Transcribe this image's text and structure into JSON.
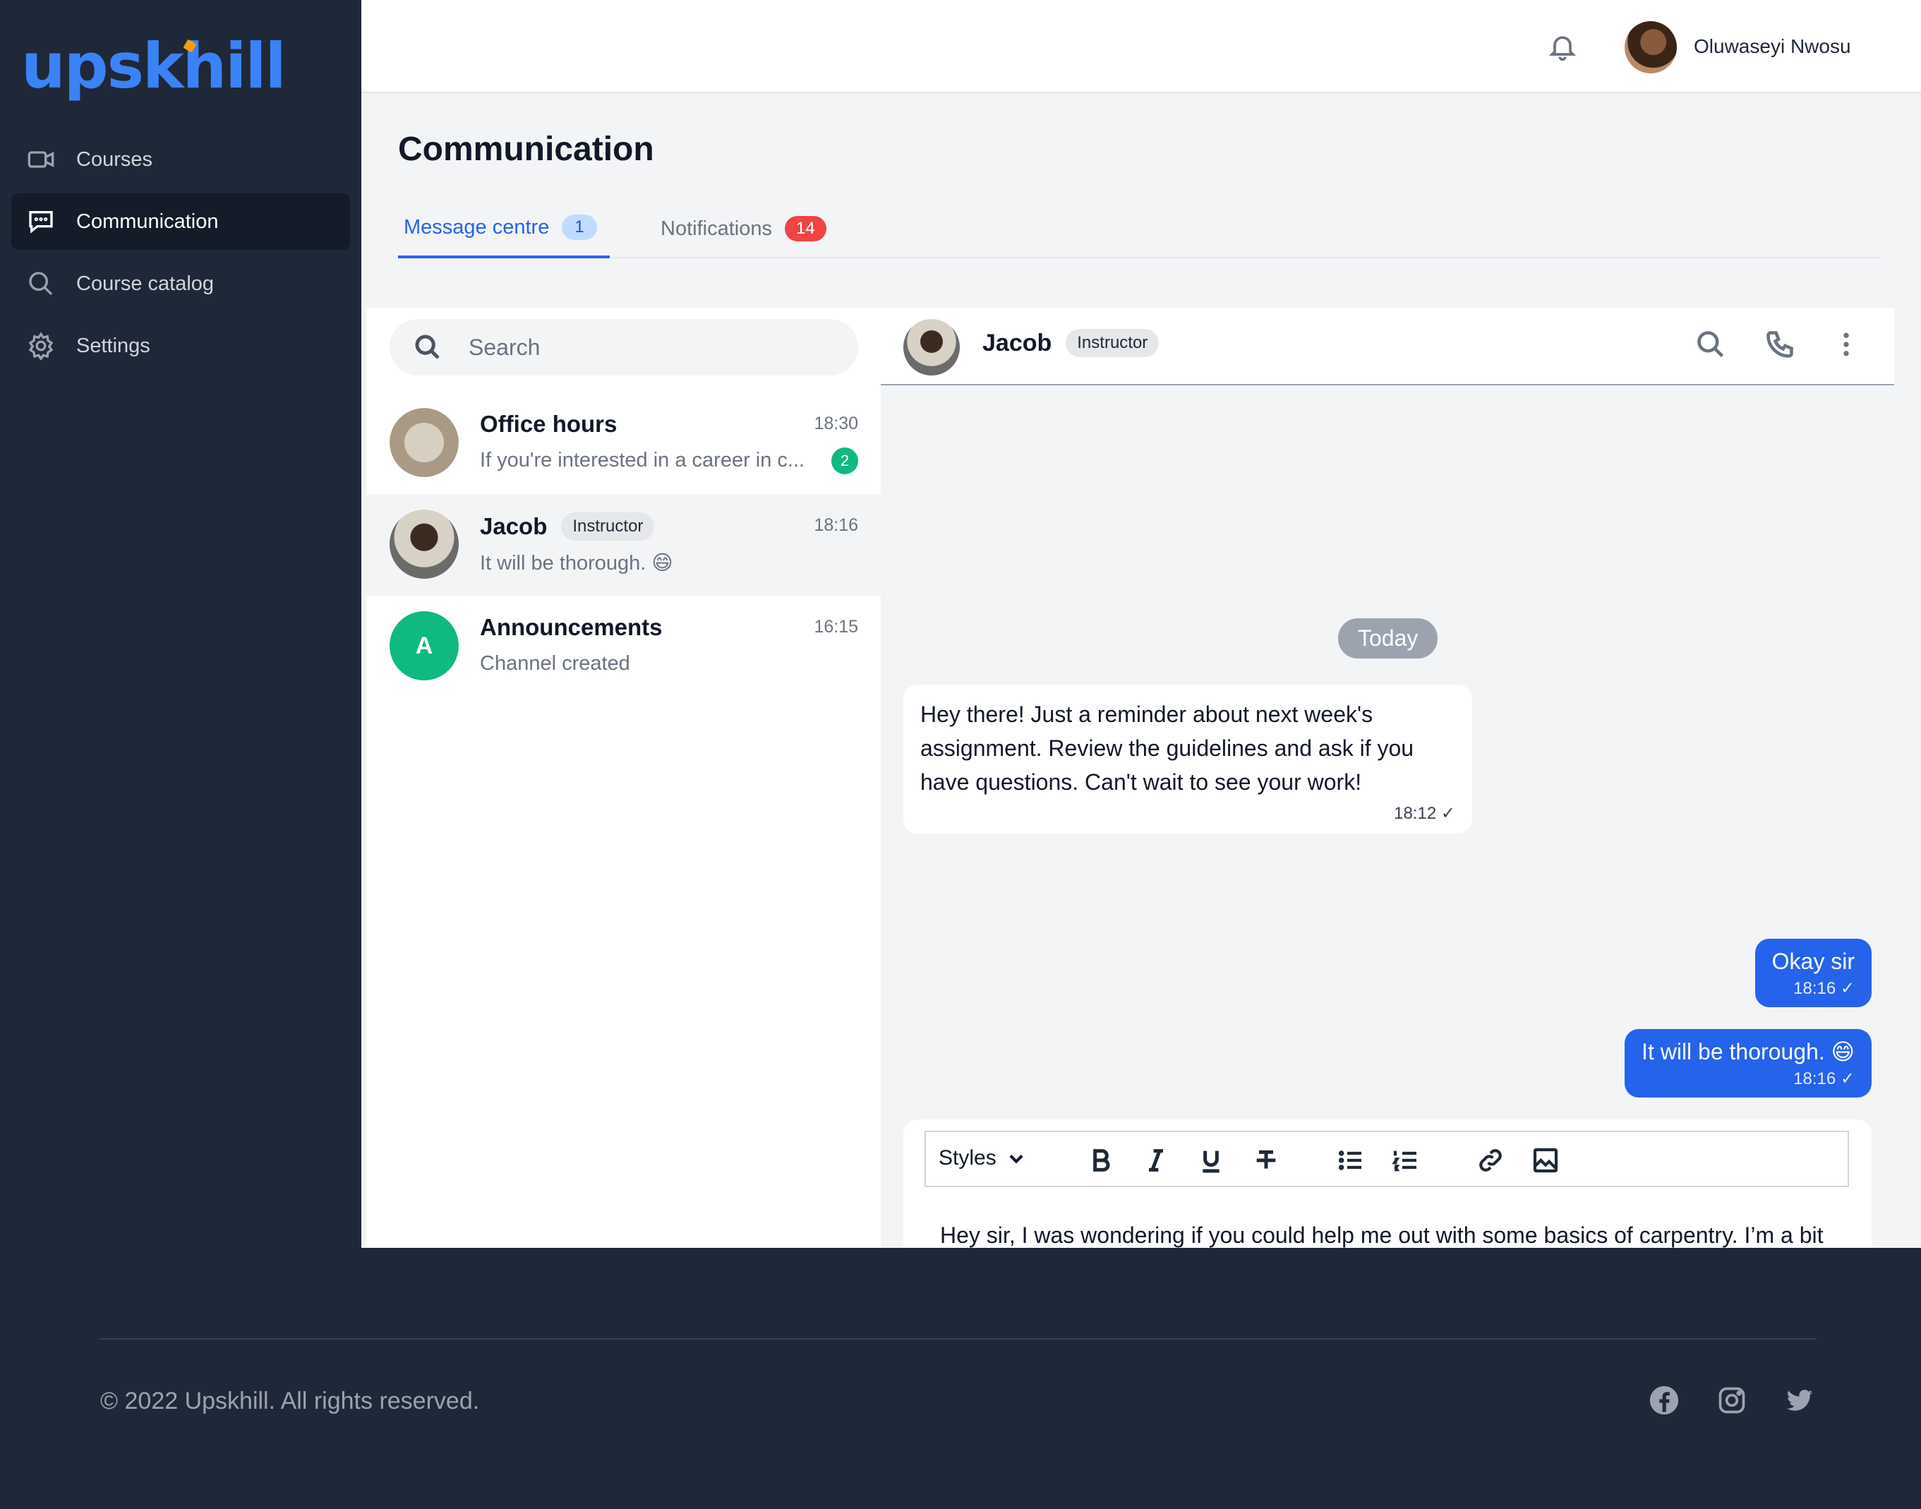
{
  "brand": {
    "logo": "upskhill"
  },
  "sidebar": {
    "items": [
      {
        "label": "Courses",
        "icon": "video-icon"
      },
      {
        "label": "Communication",
        "icon": "chat-icon",
        "active": true
      },
      {
        "label": "Course catalog",
        "icon": "search-icon"
      },
      {
        "label": "Settings",
        "icon": "gear-icon"
      }
    ]
  },
  "header": {
    "user_name": "Oluwaseyi Nwosu"
  },
  "main": {
    "title": "Communication",
    "tabs": [
      {
        "label": "Message centre",
        "badge": "1",
        "active": true
      },
      {
        "label": "Notifications",
        "badge": "14"
      }
    ]
  },
  "conversations": {
    "search_placeholder": "Search",
    "items": [
      {
        "name": "Office hours",
        "time": "18:30",
        "preview": "If you're interested in a career in c...",
        "unread": "2"
      },
      {
        "name": "Jacob",
        "role": "Instructor",
        "time": "18:16",
        "preview": "It will be thorough. 😄",
        "selected": true
      },
      {
        "name": "Announcements",
        "initial": "A",
        "time": "16:15",
        "preview": "Channel created"
      }
    ]
  },
  "chat": {
    "name": "Jacob",
    "role": "Instructor",
    "day_label": "Today",
    "messages": [
      {
        "direction": "in",
        "text": "Hey there! Just a reminder about next week's assignment. Review the guidelines and ask if you have questions. Can't wait to see your work!",
        "time": "18:12 ✓"
      },
      {
        "direction": "out",
        "text": "Okay sir",
        "time": "18:16 ✓"
      },
      {
        "direction": "out",
        "text": "It will be thorough. 😄",
        "time": "18:16 ✓"
      }
    ],
    "composer": {
      "styles_label": "Styles",
      "draft": "Hey sir, I was wondering if you could help me out with some basics of carpentry. I’m a bit confused about how to get started and what tools I really need. Can you clarify that for me?"
    }
  },
  "footer": {
    "copyright": "© 2022 Upskhill. All rights reserved."
  },
  "colors": {
    "accent": "#2563eb",
    "sidebar_bg": "#1f2838",
    "success": "#10b981",
    "danger": "#ef4444"
  }
}
